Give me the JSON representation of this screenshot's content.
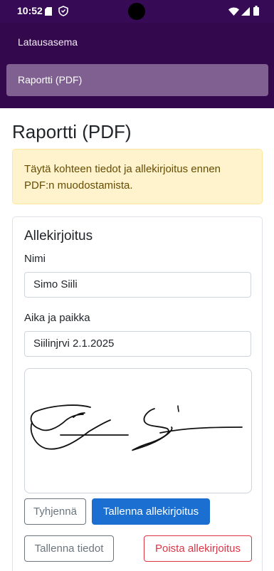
{
  "status_bar": {
    "time": "10:52",
    "icons": [
      "sd-card-icon",
      "shield-icon",
      "wifi-icon",
      "signal-icon",
      "battery-icon"
    ]
  },
  "nav": {
    "items": [
      {
        "label": "Latausasema",
        "active": false
      },
      {
        "label": "Raportti (PDF)",
        "active": true
      }
    ],
    "background": "#33084d",
    "active_background": "#7f6091"
  },
  "page": {
    "title": "Raportti (PDF)"
  },
  "alert": {
    "text": "Täytä kohteen tiedot ja allekirjoitus ennen PDF:n muodostamista."
  },
  "signature_card": {
    "title": "Allekirjoitus",
    "name_label": "Nimi",
    "name_value": "Simo Siili",
    "place_label": "Aika ja paikka",
    "place_value": "Siilinjrvi 2.1.2025",
    "buttons": {
      "clear": "Tyhjennä",
      "save_signature": "Tallenna allekirjoitus",
      "save_info": "Tallenna tiedot",
      "delete_signature": "Poista allekirjoitus"
    }
  },
  "colors": {
    "primary": "#1a6fd1",
    "danger": "#dc3545",
    "secondary": "#6c757d",
    "alert_bg": "#fff3cd"
  }
}
